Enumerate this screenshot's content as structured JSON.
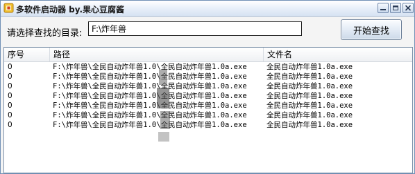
{
  "window": {
    "title": "多软件启动器 by.果心豆腐酱",
    "icon": "app-icon",
    "controls": [
      "minimize-icon",
      "maximize-icon",
      "close-icon"
    ]
  },
  "directory": {
    "label": "请选择查找的目录:",
    "value": "F:\\炸年兽"
  },
  "start_button": {
    "label": "开始查找"
  },
  "list": {
    "columns": [
      "序号",
      "路径",
      "文件名"
    ],
    "rows": [
      {
        "seq": "0",
        "path": "F:\\炸年兽\\全民自动炸年兽1.0\\全民自动炸年兽1.0a.exe",
        "fname": "全民自动炸年兽1.0a.exe"
      },
      {
        "seq": "0",
        "path": "F:\\炸年兽\\全民自动炸年兽1.0\\全民自动炸年兽1.0a.exe",
        "fname": "全民自动炸年兽1.0a.exe"
      },
      {
        "seq": "0",
        "path": "F:\\炸年兽\\全民自动炸年兽1.0\\全民自动炸年兽1.0a.exe",
        "fname": "全民自动炸年兽1.0a.exe"
      },
      {
        "seq": "0",
        "path": "F:\\炸年兽\\全民自动炸年兽1.0\\全民自动炸年兽1.0a.exe",
        "fname": "全民自动炸年兽1.0a.exe"
      },
      {
        "seq": "0",
        "path": "F:\\炸年兽\\全民自动炸年兽1.0\\全民自动炸年兽1.0a.exe",
        "fname": "全民自动炸年兽1.0a.exe"
      },
      {
        "seq": "0",
        "path": "F:\\炸年兽\\全民自动炸年兽1.0\\全民自动炸年兽1.0a.exe",
        "fname": "全民自动炸年兽1.0a.exe"
      },
      {
        "seq": "0",
        "path": "F:\\炸年兽\\全民自动炸年兽1.0\\全民自动炸年兽1.0a.exe",
        "fname": "全民自动炸年兽1.0a.exe"
      }
    ]
  },
  "colors": {
    "title_gradient_top": "#ffffff",
    "title_gradient_bottom": "#d6e2f2",
    "window_bg": "#f4f4f4",
    "list_bg": "#ffffff"
  }
}
